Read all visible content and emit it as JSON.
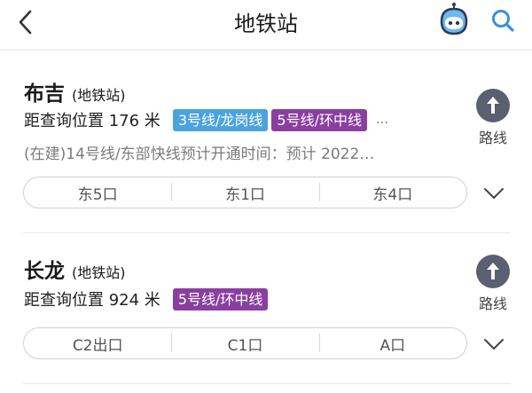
{
  "header": {
    "title": "地铁站",
    "back_icon": "chevron-left-icon",
    "assistant_icon": "robot-icon",
    "search_icon": "search-icon"
  },
  "colors": {
    "line3": "#4aa3df",
    "line5": "#8a3fa0",
    "route_button": "#5a6070"
  },
  "stations": [
    {
      "name": "布吉",
      "type": "(地铁站)",
      "distance": "距查询位置 176 米",
      "lines": [
        "3号线/龙岗线",
        "5号线/环中线"
      ],
      "more": "…",
      "note": "(在建)14号线/东部快线预计开通时间：预计 2022…",
      "exits": [
        "东5口",
        "东1口",
        "东4口"
      ],
      "route_label": "路线"
    },
    {
      "name": "长龙",
      "type": "(地铁站)",
      "distance": "距查询位置 924 米",
      "lines": [
        "5号线/环中线"
      ],
      "exits": [
        "C2出口",
        "C1口",
        "A口"
      ],
      "route_label": "路线"
    }
  ]
}
